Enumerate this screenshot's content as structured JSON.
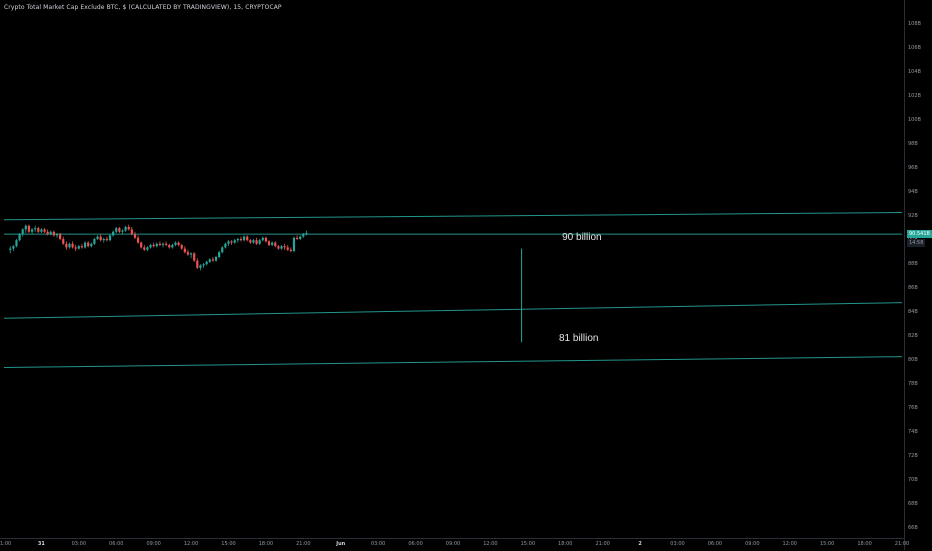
{
  "title": "Crypto Total Market Cap Exclude BTC, $ (CALCULATED BY TRADINGVIEW), 15, CRYPTOCAP",
  "colors": {
    "up": "#26a69a",
    "down": "#ef5350",
    "line": "#26a69a",
    "background": "#000000"
  },
  "price_tag": {
    "value": "90.541B",
    "sub": "14:58"
  },
  "annotations": {
    "upper": "90 billion",
    "lower": "81 billion"
  },
  "chart_data": {
    "type": "candlestick",
    "title": "Crypto Total Market Cap Exclude BTC, $ (CALCULATED BY TRADINGVIEW), 15, CRYPTOCAP",
    "y_unit": "B",
    "ylim": [
      65.2,
      110.0
    ],
    "y_ticks": [
      "108B",
      "106B",
      "104B",
      "102B",
      "100B",
      "98B",
      "96B",
      "94B",
      "92B",
      "90B",
      "88B",
      "86B",
      "84B",
      "82B",
      "80B",
      "78B",
      "76B",
      "74B",
      "72B",
      "70B",
      "68B",
      "66B"
    ],
    "y_tick_values": [
      108,
      106,
      104,
      102,
      100,
      98,
      96,
      94,
      92,
      90,
      88,
      86,
      84,
      82,
      80,
      78,
      76,
      74,
      72,
      70,
      68,
      66
    ],
    "x_ticks": [
      "21:00",
      "31",
      "03:00",
      "06:00",
      "09:00",
      "12:00",
      "15:00",
      "18:00",
      "21:00",
      "Jun",
      "03:00",
      "06:00",
      "09:00",
      "12:00",
      "15:00",
      "18:00",
      "21:00",
      "2",
      "03:00",
      "06:00",
      "09:00",
      "12:00",
      "15:00",
      "18:00",
      "21:00"
    ],
    "x_tick_index": [
      0,
      12,
      24,
      36,
      48,
      60,
      72,
      84,
      96,
      108,
      120,
      132,
      144,
      156,
      168,
      180,
      192,
      204,
      216,
      228,
      240,
      252,
      264,
      276,
      288
    ],
    "x_major": [
      "31",
      "Jun",
      "2"
    ],
    "trendlines": [
      {
        "name": "upper channel",
        "points": [
          [
            0,
            91.7
          ],
          [
            288,
            92.3
          ]
        ]
      },
      {
        "name": "middle channel",
        "points": [
          [
            0,
            83.5
          ],
          [
            288,
            84.8
          ]
        ]
      },
      {
        "name": "lower channel",
        "points": [
          [
            0,
            79.4
          ],
          [
            288,
            80.3
          ]
        ]
      },
      {
        "name": "horizontal level",
        "points": [
          [
            0,
            90.5
          ],
          [
            288,
            90.5
          ]
        ]
      }
    ],
    "measure_line": {
      "x": 166,
      "y_from": 89.3,
      "y_to": 81.5
    },
    "candles": [
      [
        89.2,
        89.5,
        88.9,
        89.3
      ],
      [
        89.3,
        89.6,
        89.1,
        89.5
      ],
      [
        89.5,
        90.1,
        89.4,
        90.0
      ],
      [
        90.0,
        90.6,
        89.9,
        90.5
      ],
      [
        90.5,
        91.0,
        90.3,
        90.9
      ],
      [
        90.9,
        91.3,
        90.6,
        91.2
      ],
      [
        91.2,
        91.3,
        90.6,
        90.7
      ],
      [
        90.7,
        91.0,
        90.5,
        90.9
      ],
      [
        90.9,
        91.2,
        90.7,
        91.0
      ],
      [
        91.0,
        91.1,
        90.6,
        90.7
      ],
      [
        90.7,
        91.0,
        90.6,
        90.9
      ],
      [
        90.9,
        91.0,
        90.6,
        90.7
      ],
      [
        90.7,
        90.9,
        90.4,
        90.5
      ],
      [
        90.5,
        90.8,
        90.4,
        90.7
      ],
      [
        90.7,
        90.8,
        90.3,
        90.4
      ],
      [
        90.4,
        90.6,
        90.2,
        90.5
      ],
      [
        90.5,
        90.6,
        90.0,
        90.1
      ],
      [
        90.1,
        90.3,
        89.6,
        89.7
      ],
      [
        89.7,
        89.9,
        89.2,
        89.4
      ],
      [
        89.4,
        89.8,
        89.3,
        89.7
      ],
      [
        89.7,
        89.9,
        89.3,
        89.4
      ],
      [
        89.4,
        89.6,
        89.1,
        89.3
      ],
      [
        89.3,
        89.6,
        89.2,
        89.5
      ],
      [
        89.5,
        89.7,
        89.3,
        89.4
      ],
      [
        89.4,
        89.9,
        89.3,
        89.8
      ],
      [
        89.8,
        89.9,
        89.4,
        89.5
      ],
      [
        89.5,
        89.8,
        89.4,
        89.7
      ],
      [
        89.7,
        90.2,
        89.6,
        90.1
      ],
      [
        90.1,
        90.4,
        90.0,
        90.3
      ],
      [
        90.3,
        90.5,
        89.9,
        90.0
      ],
      [
        90.0,
        90.2,
        89.8,
        90.1
      ],
      [
        90.1,
        90.3,
        89.9,
        90.0
      ],
      [
        90.0,
        90.5,
        89.9,
        90.4
      ],
      [
        90.4,
        90.8,
        90.3,
        90.7
      ],
      [
        90.7,
        91.1,
        90.6,
        91.0
      ],
      [
        91.0,
        91.1,
        90.6,
        90.7
      ],
      [
        90.7,
        90.9,
        90.5,
        90.8
      ],
      [
        90.8,
        91.2,
        90.7,
        91.1
      ],
      [
        91.1,
        91.3,
        90.8,
        90.9
      ],
      [
        90.9,
        91.1,
        90.4,
        90.5
      ],
      [
        90.5,
        90.7,
        90.1,
        90.2
      ],
      [
        90.2,
        90.4,
        89.7,
        89.8
      ],
      [
        89.8,
        89.9,
        89.3,
        89.4
      ],
      [
        89.4,
        89.6,
        89.1,
        89.2
      ],
      [
        89.2,
        89.5,
        89.1,
        89.4
      ],
      [
        89.4,
        89.7,
        89.3,
        89.6
      ],
      [
        89.6,
        89.8,
        89.4,
        89.5
      ],
      [
        89.5,
        89.8,
        89.4,
        89.7
      ],
      [
        89.7,
        89.9,
        89.5,
        89.6
      ],
      [
        89.6,
        89.8,
        89.4,
        89.7
      ],
      [
        89.7,
        89.9,
        89.5,
        89.6
      ],
      [
        89.6,
        89.7,
        89.3,
        89.4
      ],
      [
        89.4,
        89.7,
        89.3,
        89.6
      ],
      [
        89.6,
        89.9,
        89.5,
        89.8
      ],
      [
        89.8,
        89.9,
        89.5,
        89.6
      ],
      [
        89.6,
        89.7,
        89.2,
        89.3
      ],
      [
        89.3,
        89.5,
        88.9,
        89.0
      ],
      [
        89.0,
        89.2,
        88.7,
        88.8
      ],
      [
        88.8,
        89.0,
        88.5,
        88.9
      ],
      [
        88.9,
        89.0,
        88.2,
        88.3
      ],
      [
        88.3,
        88.5,
        87.6,
        87.7
      ],
      [
        87.7,
        88.0,
        87.5,
        87.9
      ],
      [
        87.9,
        88.1,
        87.7,
        88.0
      ],
      [
        88.0,
        88.3,
        87.9,
        88.2
      ],
      [
        88.2,
        88.5,
        88.1,
        88.4
      ],
      [
        88.4,
        88.6,
        88.2,
        88.3
      ],
      [
        88.3,
        88.7,
        88.2,
        88.6
      ],
      [
        88.6,
        89.1,
        88.5,
        89.0
      ],
      [
        89.0,
        89.5,
        88.9,
        89.4
      ],
      [
        89.4,
        89.8,
        89.3,
        89.7
      ],
      [
        89.7,
        90.0,
        89.5,
        89.9
      ],
      [
        89.9,
        90.0,
        89.6,
        89.8
      ],
      [
        89.8,
        90.1,
        89.7,
        90.0
      ],
      [
        90.0,
        90.2,
        89.8,
        90.1
      ],
      [
        90.1,
        90.3,
        89.9,
        90.0
      ],
      [
        90.0,
        90.4,
        89.9,
        90.3
      ],
      [
        90.3,
        90.4,
        89.9,
        90.0
      ],
      [
        90.0,
        90.1,
        89.7,
        89.8
      ],
      [
        89.8,
        90.1,
        89.7,
        90.0
      ],
      [
        90.0,
        90.2,
        89.6,
        89.7
      ],
      [
        89.7,
        90.1,
        89.6,
        90.0
      ],
      [
        90.0,
        90.3,
        89.9,
        90.2
      ],
      [
        90.2,
        90.3,
        89.8,
        89.9
      ],
      [
        89.9,
        90.0,
        89.5,
        89.6
      ],
      [
        89.6,
        89.9,
        89.5,
        89.8
      ],
      [
        89.8,
        89.9,
        89.4,
        89.5
      ],
      [
        89.5,
        89.6,
        89.2,
        89.3
      ],
      [
        89.3,
        89.6,
        89.2,
        89.5
      ],
      [
        89.5,
        89.7,
        89.2,
        89.4
      ],
      [
        89.4,
        89.6,
        89.1,
        89.2
      ],
      [
        89.2,
        89.4,
        89.0,
        89.1
      ],
      [
        89.1,
        90.3,
        89.0,
        90.2
      ],
      [
        90.2,
        90.4,
        90.0,
        90.1
      ],
      [
        90.1,
        90.4,
        90.0,
        90.3
      ],
      [
        90.3,
        90.6,
        90.2,
        90.5
      ],
      [
        90.5,
        90.8,
        90.4,
        90.6
      ]
    ]
  }
}
